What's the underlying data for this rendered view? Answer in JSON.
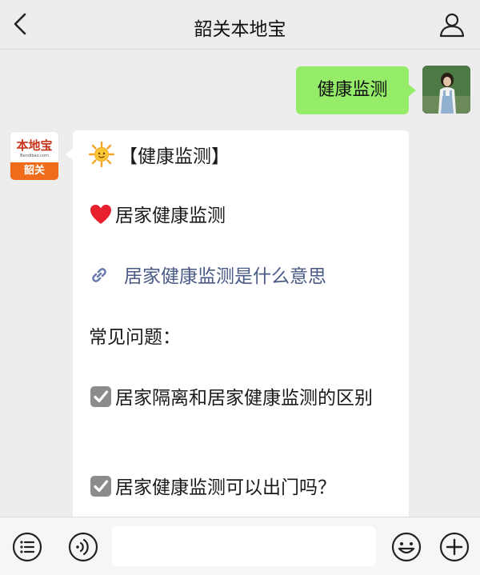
{
  "header": {
    "title": "韶关本地宝",
    "back_icon": "chevron-left-icon",
    "profile_icon": "person-icon"
  },
  "messages": {
    "user": {
      "text": "健康监测",
      "avatar": "user-avatar"
    },
    "bot": {
      "avatar": {
        "logo_text": "本地宝",
        "logo_url": "Bendibao.com",
        "city": "韶关"
      },
      "title": "【健康监测】",
      "subtitle": "居家健康监测",
      "link": "居家健康监测是什么意思",
      "faq_heading": "常见问题：",
      "faq": [
        "居家隔离和居家健康监测的区别",
        "居家健康监测可以出门吗？"
      ]
    }
  },
  "colors": {
    "user_bubble": "#95ec69",
    "link": "#4a5a86",
    "logo_orange": "#ef6c1a",
    "logo_red": "#c8341b"
  },
  "toolbar": {
    "menu_icon": "list-icon",
    "voice_icon": "voice-icon",
    "input_value": "",
    "emoji_icon": "smiley-icon",
    "add_icon": "plus-icon"
  }
}
